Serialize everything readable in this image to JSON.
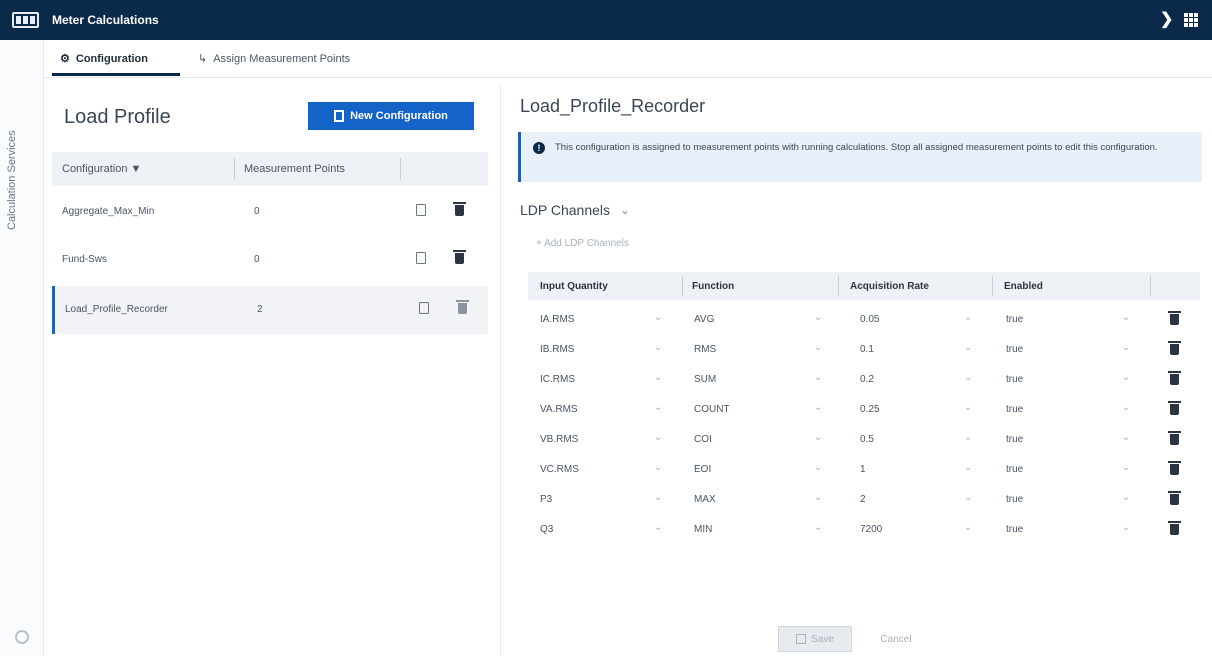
{
  "app": {
    "title": "Meter Calculations"
  },
  "side_rail": {
    "label": "Calculation Services"
  },
  "tabs": [
    {
      "label": "Configuration",
      "icon": "gear-icon",
      "active": true
    },
    {
      "label": "Assign Measurement Points",
      "icon": "assign-icon",
      "active": false
    }
  ],
  "left": {
    "heading": "Load Profile",
    "new_button": "New Configuration",
    "columns": {
      "configuration": "Configuration",
      "measurement_points": "Measurement Points"
    },
    "rows": [
      {
        "name": "Aggregate_Max_Min",
        "points": "0"
      },
      {
        "name": "Fund-Sws",
        "points": "0"
      },
      {
        "name": "Load_Profile_Recorder",
        "points": "2",
        "selected": true
      }
    ]
  },
  "right": {
    "title": "Load_Profile_Recorder",
    "info": "This configuration is assigned to measurement points with running calculations. Stop all assigned measurement points to edit this configuration.",
    "section": "LDP Channels",
    "add_label": "Add LDP Channels",
    "columns": {
      "input": "Input Quantity",
      "function": "Function",
      "rate": "Acquisition Rate",
      "enabled": "Enabled"
    },
    "rows": [
      {
        "input": "IA.RMS",
        "function": "AVG",
        "rate": "0.05",
        "enabled": "true"
      },
      {
        "input": "IB.RMS",
        "function": "RMS",
        "rate": "0.1",
        "enabled": "true"
      },
      {
        "input": "IC.RMS",
        "function": "SUM",
        "rate": "0.2",
        "enabled": "true"
      },
      {
        "input": "VA.RMS",
        "function": "COUNT",
        "rate": "0.25",
        "enabled": "true"
      },
      {
        "input": "VB.RMS",
        "function": "COI",
        "rate": "0.5",
        "enabled": "true"
      },
      {
        "input": "VC.RMS",
        "function": "EOI",
        "rate": "1",
        "enabled": "true"
      },
      {
        "input": "P3",
        "function": "MAX",
        "rate": "2",
        "enabled": "true"
      },
      {
        "input": "Q3",
        "function": "MIN",
        "rate": "7200",
        "enabled": "true"
      }
    ]
  },
  "footer": {
    "save": "Save",
    "cancel": "Cancel"
  },
  "colors": {
    "header": "#0b2a4a",
    "accent": "#1463c8",
    "info_bg": "#e8f0f9"
  }
}
